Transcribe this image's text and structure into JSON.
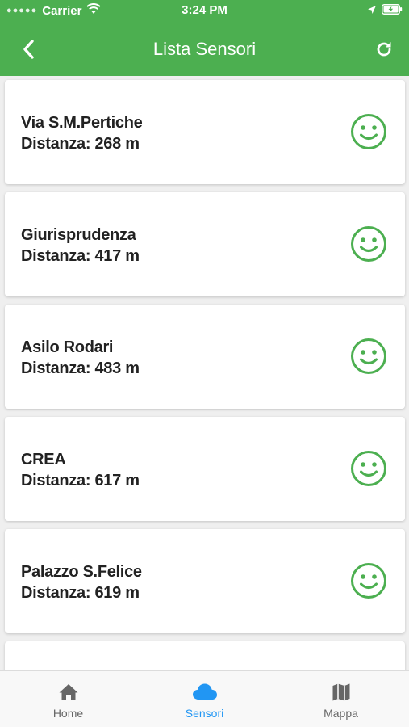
{
  "status_bar": {
    "carrier": "Carrier",
    "time": "3:24 PM"
  },
  "header": {
    "title": "Lista Sensori"
  },
  "colors": {
    "header": "#4caf50",
    "smiley": "#4caf50",
    "tab_active": "#2196f3",
    "tab_inactive": "#666666"
  },
  "sensors": [
    {
      "name": "Via S.M.Pertiche",
      "distance": "Distanza: 268 m",
      "status_icon": "smiley-icon"
    },
    {
      "name": "Giurisprudenza",
      "distance": "Distanza: 417 m",
      "status_icon": "smiley-icon"
    },
    {
      "name": "Asilo Rodari",
      "distance": "Distanza: 483 m",
      "status_icon": "smiley-icon"
    },
    {
      "name": "CREA",
      "distance": "Distanza: 617 m",
      "status_icon": "smiley-icon"
    },
    {
      "name": "Palazzo S.Felice",
      "distance": "Distanza: 619 m",
      "status_icon": "smiley-icon"
    }
  ],
  "tabbar": {
    "tabs": [
      {
        "label": "Home",
        "icon": "home-icon",
        "active": false
      },
      {
        "label": "Sensori",
        "icon": "cloud-icon",
        "active": true
      },
      {
        "label": "Mappa",
        "icon": "map-icon",
        "active": false
      }
    ]
  }
}
